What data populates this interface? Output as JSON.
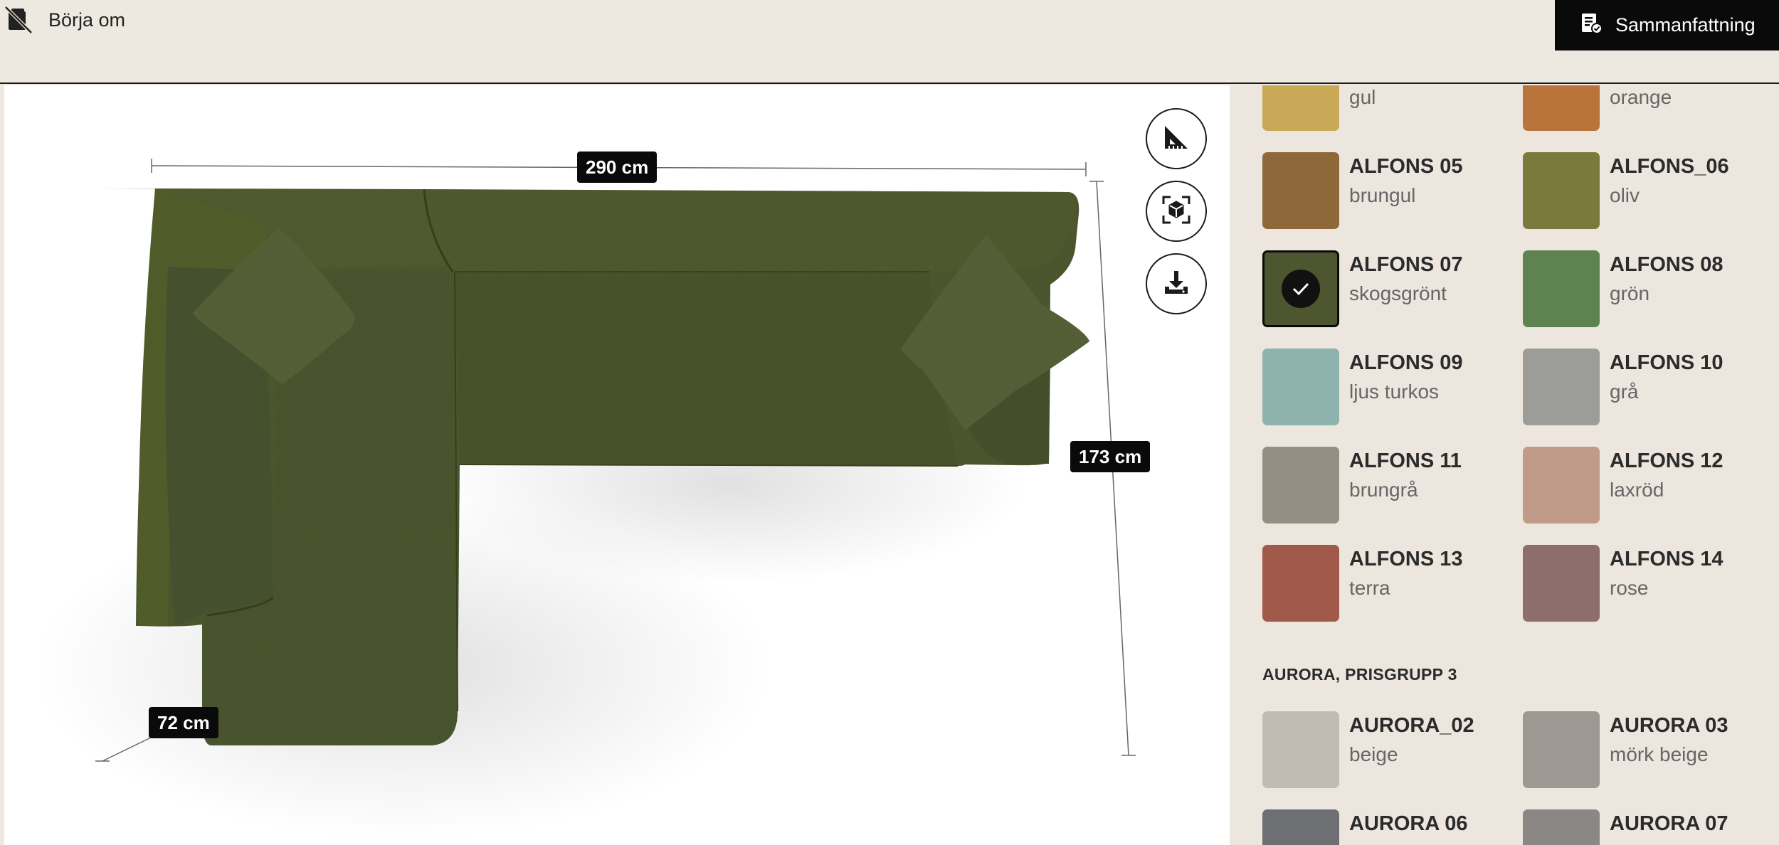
{
  "header": {
    "restart_label": "Börja om",
    "restart_icon": "restart-sofa-icon",
    "summary_label": "Sammanfattning",
    "summary_icon": "summary-checklist-icon"
  },
  "viewer": {
    "dimensions": {
      "width": "290 cm",
      "depth": "173 cm",
      "chaise_width": "72 cm"
    },
    "sofa_color": "#4f5a30",
    "tools": [
      {
        "name": "measure-tool-button",
        "icon": "ruler-triangle-icon"
      },
      {
        "name": "ar-view-button",
        "icon": "ar-cube-icon"
      },
      {
        "name": "download-button",
        "icon": "download-icon"
      }
    ]
  },
  "panel": {
    "swatches": [
      {
        "code": "",
        "label": "gul",
        "color": "#c9a957"
      },
      {
        "code": "",
        "label": "orange",
        "color": "#b8743a"
      },
      {
        "code": "ALFONS 05",
        "label": "brungul",
        "color": "#8e6838"
      },
      {
        "code": "ALFONS_06",
        "label": "oliv",
        "color": "#7a7a3c"
      },
      {
        "code": "ALFONS 07",
        "label": "skogsgrönt",
        "color": "#4e5630",
        "selected": true
      },
      {
        "code": "ALFONS 08",
        "label": "grön",
        "color": "#5f8350"
      },
      {
        "code": "ALFONS 09",
        "label": "ljus turkos",
        "color": "#8eb2ad"
      },
      {
        "code": "ALFONS 10",
        "label": "grå",
        "color": "#9c9c98"
      },
      {
        "code": "ALFONS 11",
        "label": "brungrå",
        "color": "#958e82"
      },
      {
        "code": "ALFONS 12",
        "label": "laxröd",
        "color": "#c09b8a"
      },
      {
        "code": "ALFONS 13",
        "label": "terra",
        "color": "#a15a4a"
      },
      {
        "code": "ALFONS 14",
        "label": "rose",
        "color": "#8e6e6a"
      }
    ],
    "group_heading": "AURORA, PRISGRUPP 3",
    "aurora": [
      {
        "code": "AURORA_02",
        "label": "beige",
        "color": "#c1bcb3"
      },
      {
        "code": "AURORA 03",
        "label": "mörk beige",
        "color": "#9e9792"
      },
      {
        "code": "AURORA 06",
        "label": "",
        "color": "#6e6f73"
      },
      {
        "code": "AURORA 07",
        "label": "",
        "color": "#8a8785"
      }
    ]
  }
}
